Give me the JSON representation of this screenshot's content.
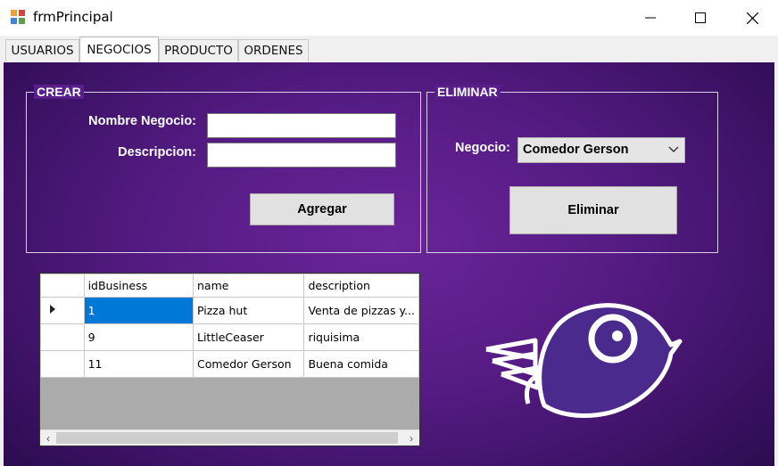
{
  "window": {
    "title": "frmPrincipal"
  },
  "tabs": [
    {
      "label": "USUARIOS"
    },
    {
      "label": "NEGOCIOS"
    },
    {
      "label": "PRODUCTO"
    },
    {
      "label": "ORDENES"
    }
  ],
  "crear": {
    "title": "CREAR",
    "nombre_label": "Nombre Negocio:",
    "nombre_value": "",
    "descripcion_label": "Descripcion:",
    "descripcion_value": "",
    "add_label": "Agregar"
  },
  "eliminar": {
    "title": "ELIMINAR",
    "negocio_label": "Negocio:",
    "negocio_selected": "Comedor Gerson",
    "delete_label": "Eliminar"
  },
  "grid": {
    "columns": [
      "idBusiness",
      "name",
      "description"
    ],
    "rows": [
      [
        "1",
        "Pizza hut",
        "Venta de pizzas y..."
      ],
      [
        "9",
        "LittleCeaser",
        "riquisima"
      ],
      [
        "11",
        "Comedor Gerson",
        "Buena comida"
      ]
    ]
  },
  "colors": {
    "panel": "#571c86",
    "selection": "#0078d7",
    "button": "#e1e1e1"
  },
  "icons": [
    "app-icon",
    "minimize-icon",
    "maximize-icon",
    "close-icon",
    "chevron-down-icon",
    "row-pointer-icon",
    "scroll-left-icon",
    "scroll-right-icon",
    "bird-logo"
  ]
}
